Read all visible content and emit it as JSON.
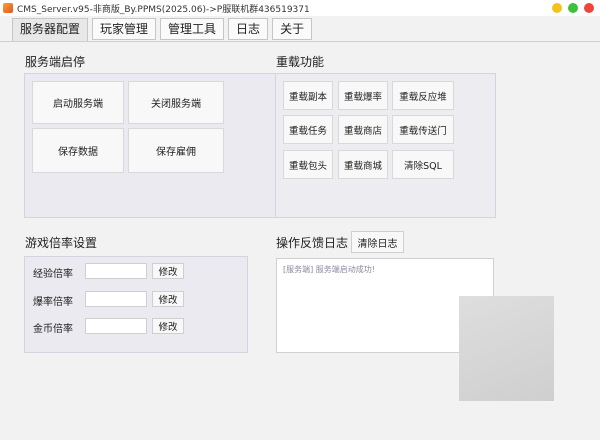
{
  "window": {
    "title": "CMS_Server.v95-非商版_By.PPMS(2025.06)->P服联机群436519371"
  },
  "tabs": [
    {
      "label": "服务器配置"
    },
    {
      "label": "玩家管理"
    },
    {
      "label": "管理工具"
    },
    {
      "label": "日志"
    },
    {
      "label": "关于"
    }
  ],
  "server": {
    "title": "服务端启停",
    "start": "启动服务端",
    "stop": "关闭服务端",
    "save_data": "保存数据",
    "save_employ": "保存雇佣"
  },
  "reload": {
    "title": "重载功能",
    "buttons": [
      "重载副本",
      "重载爆率",
      "重载反应堆",
      "重载任务",
      "重载商店",
      "重载传送门",
      "重载包头",
      "重载商城",
      "清除SQL"
    ]
  },
  "rates": {
    "title": "游戏倍率设置",
    "exp_label": "经验倍率",
    "drop_label": "爆率倍率",
    "gold_label": "金币倍率",
    "modify": "修改"
  },
  "log": {
    "title": "操作反馈日志",
    "clear": "清除日志",
    "entry": "[服务端] 服务端启动成功!"
  },
  "colors": {
    "panel_bg": "#eaeaf0",
    "window_bg": "#f2f2f2"
  }
}
